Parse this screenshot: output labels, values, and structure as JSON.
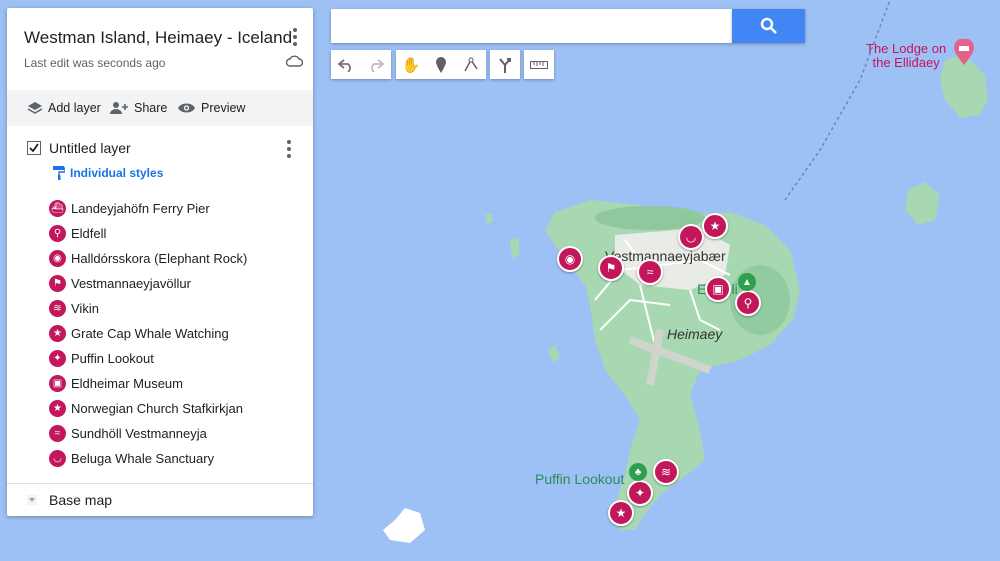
{
  "map": {
    "town_label": "Vestmannaeyjabær",
    "island_label": "Heimaey",
    "town_fragment": "El",
    "town_fragment2": "li",
    "puffin_label": "Puffin Lookout",
    "lodge_label_line1": "The Lodge on",
    "lodge_label_line2": "the Elliđaey",
    "colors": {
      "water": "#9dc0f5",
      "land": "#a8d8b2",
      "marker": "#c2185b",
      "green_poi": "#2e9e4f"
    }
  },
  "panel": {
    "title": "Westman Island, Heimaey - Iceland",
    "subtitle": "Last edit was seconds ago",
    "actions": {
      "add_layer": "Add layer",
      "share": "Share",
      "preview": "Preview"
    },
    "layer": {
      "name": "Untitled layer",
      "checked": true,
      "styles_label": "Individual styles",
      "places": [
        {
          "label": "Landeyjahöfn Ferry Pier",
          "icon": "ferry-icon"
        },
        {
          "label": "Eldfell",
          "icon": "hiker-icon"
        },
        {
          "label": "Halldórsskora (Elephant Rock)",
          "icon": "camera-icon"
        },
        {
          "label": "Vestmannaeyjavöllur",
          "icon": "golf-icon"
        },
        {
          "label": "Vikin",
          "icon": "surf-icon"
        },
        {
          "label": "Grate Cap Whale Watching",
          "icon": "star-icon"
        },
        {
          "label": "Puffin Lookout",
          "icon": "bird-icon"
        },
        {
          "label": "Eldheimar Museum",
          "icon": "museum-icon"
        },
        {
          "label": "Norwegian Church Stafkirkjan",
          "icon": "star-icon"
        },
        {
          "label": "Sundhöll Vestmanneyja",
          "icon": "swim-icon"
        },
        {
          "label": "Beluga Whale Sanctuary",
          "icon": "whale-icon"
        }
      ]
    },
    "base_map_label": "Base map"
  },
  "search": {
    "placeholder": ""
  }
}
